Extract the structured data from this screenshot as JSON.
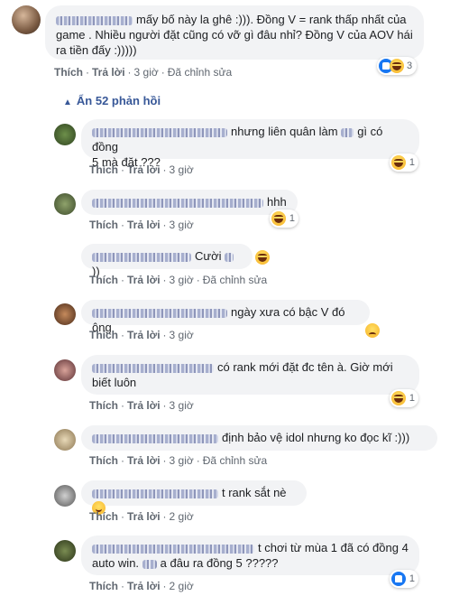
{
  "main_comment": {
    "text_line1": "mấy bố này la ghê :))). Đồng V = rank thấp nhất của",
    "text_line2": "game . Nhiều người đặt cũng có vỡ gì đâu nhỉ? Đồng V của AOV hái",
    "text_line3": "ra tiền đấy :)))))",
    "like": "Thích",
    "reply": "Trả lời",
    "time": "3 giờ",
    "edited": "Đã chỉnh sửa",
    "reaction_count": "3"
  },
  "hide_replies": "Ẩn 52 phản hồi",
  "replies": [
    {
      "line1": "nhưng liên quân làm",
      "line1b": "gì có đồng",
      "line2": "5 mà đặt ???",
      "like": "Thích",
      "reply": "Trả lời",
      "time": "3 giờ",
      "count": "1"
    },
    {
      "line1": "hhh",
      "like": "Thích",
      "reply": "Trả lời",
      "time": "3 giờ",
      "count": "1"
    },
    {
      "line1": "Cười",
      "line1b": "))",
      "like": "Thích",
      "reply": "Trả lời",
      "time": "3 giờ",
      "edited": "Đã chỉnh sửa"
    },
    {
      "line1": "ngày xưa có bậc V đó ông",
      "like": "Thích",
      "reply": "Trả lời",
      "time": "3 giờ"
    },
    {
      "line1": "có rank mới đặt đc tên à. Giờ mới",
      "line2": "biết luôn",
      "like": "Thích",
      "reply": "Trả lời",
      "time": "3 giờ",
      "count": "1"
    },
    {
      "line1": "định bảo vệ idol nhưng ko đọc kĩ :)))",
      "like": "Thích",
      "reply": "Trả lời",
      "time": "3 giờ",
      "edited": "Đã chỉnh sửa"
    },
    {
      "line1": "t rank sắt nè",
      "like": "Thích",
      "reply": "Trả lời",
      "time": "2 giờ"
    },
    {
      "line1": "t chơi từ mùa 1 đã có đồng 4",
      "line2": "auto win.",
      "line2b": "a đâu ra đồng 5 ?????",
      "like": "Thích",
      "reply": "Trả lời",
      "time": "2 giờ",
      "count": "1"
    }
  ],
  "colors": {
    "bubble": "#f2f3f5",
    "link": "#385898",
    "meta": "#606770",
    "like_blue": "#1877f2"
  }
}
